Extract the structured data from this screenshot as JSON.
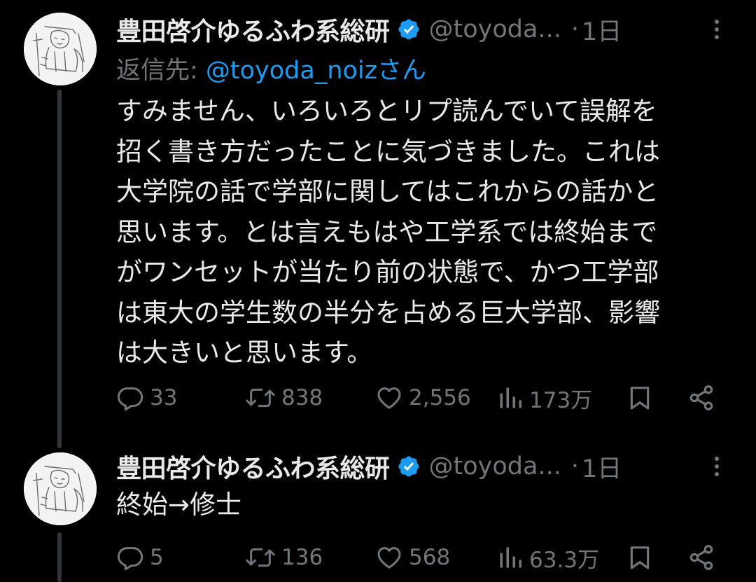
{
  "colors": {
    "background": "#000000",
    "text_primary": "#e7e9ea",
    "text_secondary": "#71767b",
    "accent": "#1d9bf0",
    "thread_line": "#333639"
  },
  "tweets": [
    {
      "author": {
        "display_name": "豊田啓介ゆるふわ系総研",
        "handle": "@toyoda...",
        "verified_icon": "verified-badge-icon",
        "avatar": "sketch-portrait-avatar"
      },
      "separator": "·",
      "time": "1日",
      "reply_to": {
        "prefix": "返信先: ",
        "mention": "@toyoda_noiz",
        "suffix": "さん"
      },
      "body_lines": [
        "すみません、いろいろとリプ読んでいて誤解を",
        "招く書き方だったことに気づきました。これは",
        "大学院の話で学部に関してはこれからの話かと",
        "思います。とは言えもはや工学系では終始まで",
        "がワンセットが当たり前の状態で、かつ工学部",
        "は東大の学生数の半分を占める巨大学部、影響",
        "は大きいと思います。"
      ],
      "actions": {
        "replies": "33",
        "retweets": "838",
        "likes": "2,556",
        "views": "173万"
      }
    },
    {
      "author": {
        "display_name": "豊田啓介ゆるふわ系総研",
        "handle": "@toyoda...",
        "verified_icon": "verified-badge-icon",
        "avatar": "sketch-portrait-avatar"
      },
      "separator": "·",
      "time": "1日",
      "body_lines": [
        "終始→修士"
      ],
      "actions": {
        "replies": "5",
        "retweets": "136",
        "likes": "568",
        "views": "63.3万"
      }
    }
  ]
}
